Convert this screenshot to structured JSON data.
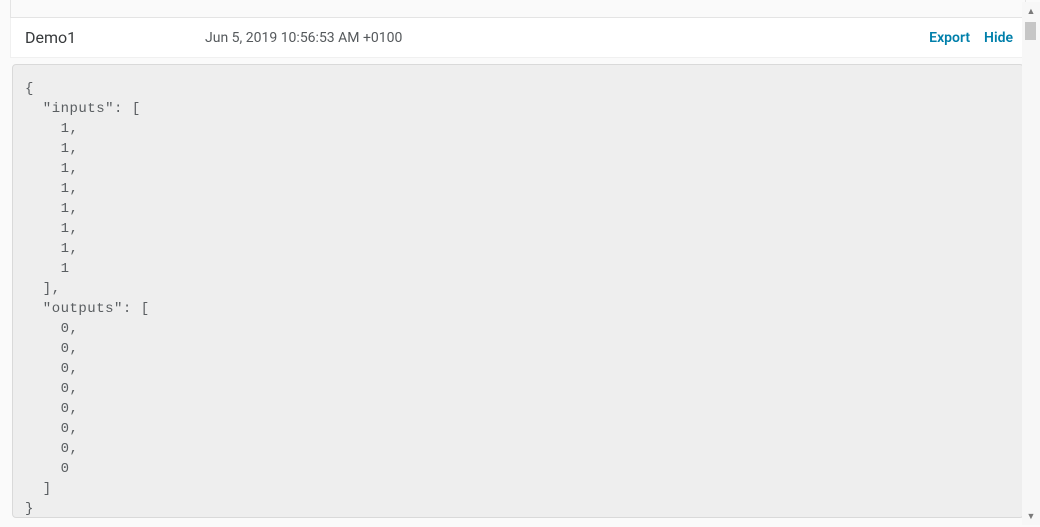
{
  "header": {
    "title": "Demo1",
    "timestamp": "Jun 5, 2019 10:56:53 AM +0100",
    "export_label": "Export",
    "hide_label": "Hide"
  },
  "code_body": {
    "inputs": [
      1,
      1,
      1,
      1,
      1,
      1,
      1,
      1
    ],
    "outputs": [
      0,
      0,
      0,
      0,
      0,
      0,
      0,
      0
    ]
  },
  "code_text": "{\n  \"inputs\": [\n    1,\n    1,\n    1,\n    1,\n    1,\n    1,\n    1,\n    1\n  ],\n  \"outputs\": [\n    0,\n    0,\n    0,\n    0,\n    0,\n    0,\n    0,\n    0\n  ]\n}",
  "scrollbar": {
    "up_glyph": "▲",
    "down_glyph": "▼"
  }
}
